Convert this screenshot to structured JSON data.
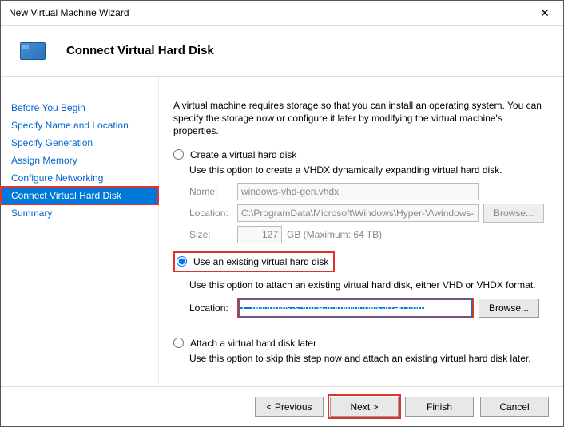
{
  "window": {
    "title": "New Virtual Machine Wizard"
  },
  "header": {
    "title": "Connect Virtual Hard Disk"
  },
  "sidebar": {
    "items": [
      {
        "label": "Before You Begin"
      },
      {
        "label": "Specify Name and Location"
      },
      {
        "label": "Specify Generation"
      },
      {
        "label": "Assign Memory"
      },
      {
        "label": "Configure Networking"
      },
      {
        "label": "Connect Virtual Hard Disk"
      },
      {
        "label": "Summary"
      }
    ]
  },
  "main": {
    "intro": "A virtual machine requires storage so that you can install an operating system. You can specify the storage now or configure it later by modifying the virtual machine's properties.",
    "opt1": {
      "label": "Create a virtual hard disk",
      "desc": "Use this option to create a VHDX dynamically expanding virtual hard disk.",
      "name_label": "Name:",
      "name_value": "windows-vhd-gen.vhdx",
      "loc_label": "Location:",
      "loc_value": "C:\\ProgramData\\Microsoft\\Windows\\Hyper-V\\windows-vhd-gen\\Vir",
      "browse": "Browse...",
      "size_label": "Size:",
      "size_value": "127",
      "size_suffix": "GB (Maximum: 64 TB)"
    },
    "opt2": {
      "label": "Use an existing virtual hard disk",
      "desc": "Use this option to attach an existing virtual hard disk, either VHD or VHDX format.",
      "loc_label": "Location:",
      "loc_value": "C:\\windows-source-vhd\\windows-fixed.vhd",
      "browse": "Browse..."
    },
    "opt3": {
      "label": "Attach a virtual hard disk later",
      "desc": "Use this option to skip this step now and attach an existing virtual hard disk later."
    }
  },
  "footer": {
    "previous": "< Previous",
    "next": "Next >",
    "finish": "Finish",
    "cancel": "Cancel"
  }
}
